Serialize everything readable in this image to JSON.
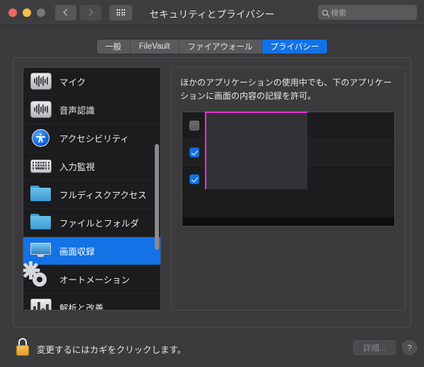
{
  "window": {
    "title": "セキュリティとプライバシー",
    "traffic_lights": [
      "close",
      "minimize",
      "zoom-disabled"
    ],
    "nav": {
      "back": "back-chevron",
      "forward": "forward-chevron",
      "grid": "show-all-grid"
    },
    "search": {
      "placeholder": "検索",
      "icon": "search-icon"
    }
  },
  "tabs": [
    {
      "label": "一般",
      "active": false
    },
    {
      "label": "FileVault",
      "active": false
    },
    {
      "label": "ファイアウォール",
      "active": false
    },
    {
      "label": "プライバシー",
      "active": true
    }
  ],
  "sidebar": {
    "items": [
      {
        "label": "マイク",
        "icon": "microphone-waveform-icon",
        "selected": false
      },
      {
        "label": "音声認識",
        "icon": "speech-recognition-waveform-icon",
        "selected": false
      },
      {
        "label": "アクセシビリティ",
        "icon": "accessibility-icon",
        "selected": false
      },
      {
        "label": "入力監視",
        "icon": "keyboard-icon",
        "selected": false
      },
      {
        "label": "フルディスクアクセス",
        "icon": "folder-icon",
        "selected": false
      },
      {
        "label": "ファイルとフォルダ",
        "icon": "folder-icon",
        "selected": false
      },
      {
        "label": "画面収録",
        "icon": "display-monitor-icon",
        "selected": true
      },
      {
        "label": "オートメーション",
        "icon": "gear-icon",
        "selected": false
      },
      {
        "label": "解析と改善",
        "icon": "bar-chart-icon",
        "selected": false
      }
    ],
    "scrollbar": "vertical-scrollbar"
  },
  "main": {
    "description": "ほかのアプリケーションの使用中でも、下のアプリケーションに画面の内容の記録を許可。",
    "app_rows": [
      {
        "checked": false,
        "name": ""
      },
      {
        "checked": true,
        "name": ""
      },
      {
        "checked": true,
        "name": ""
      }
    ],
    "redaction": {
      "accent": "#ee2ce0"
    }
  },
  "bottom": {
    "lock_icon": "unlocked-padlock-icon",
    "lock_text": "変更するにはカギをクリックします。",
    "advanced_label": "詳細...",
    "help_label": "?"
  },
  "colors": {
    "accent_blue": "#1272e6",
    "magenta": "#ee2ce0",
    "lock_gold": "#f0ad2a"
  }
}
